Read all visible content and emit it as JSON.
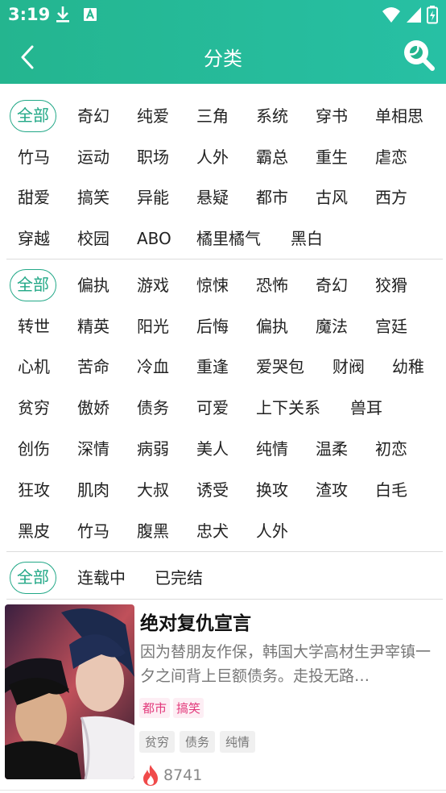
{
  "status_bar": {
    "time": "3:19"
  },
  "header": {
    "title": "分类"
  },
  "colors": {
    "accent": "#22a887",
    "header": "#24b58f",
    "pink_tag_bg": "#fdeef4",
    "pink_tag_text": "#e2387a"
  },
  "icons": [
    "download-icon",
    "a-notification-icon",
    "wifi-icon",
    "signal-icon",
    "battery-icon",
    "back-arrow-icon",
    "search-icon",
    "fire-icon"
  ],
  "category_filter": {
    "rows": [
      [
        "全部",
        "奇幻",
        "纯爱",
        "三角",
        "系统",
        "穿书",
        "单相思"
      ],
      [
        "竹马",
        "运动",
        "职场",
        "人外",
        "霸总",
        "重生",
        "虐恋"
      ],
      [
        "甜爱",
        "搞笑",
        "异能",
        "悬疑",
        "都市",
        "古风",
        "西方"
      ],
      [
        "穿越",
        "校园",
        "ABO",
        "橘里橘气",
        "黑白"
      ]
    ]
  },
  "tag_filter": {
    "rows": [
      [
        "全部",
        "偏执",
        "游戏",
        "惊悚",
        "恐怖",
        "奇幻",
        "狡猾"
      ],
      [
        "转世",
        "精英",
        "阳光",
        "后悔",
        "偏执",
        "魔法",
        "宫廷"
      ],
      [
        "心机",
        "苦命",
        "冷血",
        "重逢",
        "爱哭包",
        "财阀",
        "幼稚"
      ],
      [
        "贫穷",
        "傲娇",
        "债务",
        "可爱",
        "上下关系",
        "兽耳"
      ],
      [
        "创伤",
        "深情",
        "病弱",
        "美人",
        "纯情",
        "温柔",
        "初恋"
      ],
      [
        "狂攻",
        "肌肉",
        "大叔",
        "诱受",
        "换攻",
        "渣攻",
        "白毛"
      ],
      [
        "黑皮",
        "竹马",
        "腹黑",
        "忠犬",
        "人外"
      ]
    ]
  },
  "status_filter": {
    "rows": [
      [
        "全部",
        "连载中",
        "已完结"
      ]
    ]
  },
  "books": [
    {
      "title": "绝对复仇宣言",
      "description": "因为替朋友作保，韩国大学高材生尹宰镇一夕之间背上巨额债务。走投无路…",
      "genre_tags": [
        "都市",
        "搞笑"
      ],
      "tags": [
        "贫穷",
        "债务",
        "纯情"
      ],
      "hot": "8741"
    }
  ]
}
